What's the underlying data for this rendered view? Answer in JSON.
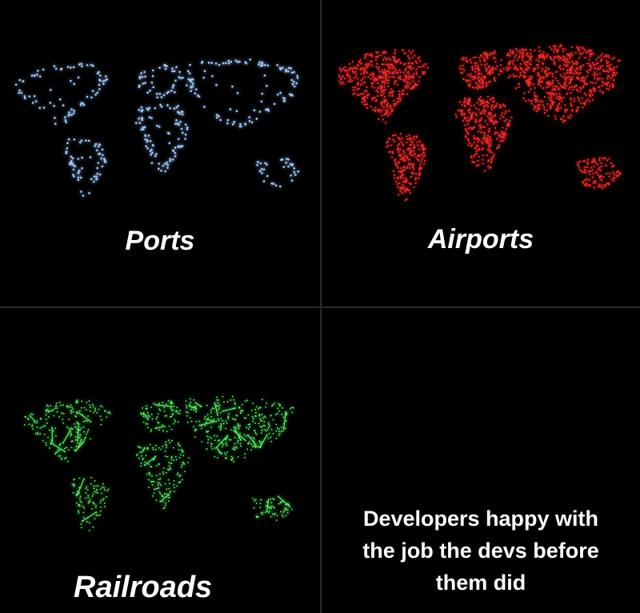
{
  "panels": [
    {
      "label": "Ports",
      "color": "#9ec8ff",
      "glow": "#3f7dff",
      "style": "dots-coastal"
    },
    {
      "label": "Airports",
      "color": "#ff2a2a",
      "glow": "#ff0000",
      "style": "dots-dense"
    },
    {
      "label": "Railroads",
      "color": "#5dff6a",
      "glow": "#19e02a",
      "style": "lines"
    }
  ],
  "caption": {
    "line1": "Developers happy with",
    "line2": "the job the devs before",
    "line3": "them did"
  }
}
